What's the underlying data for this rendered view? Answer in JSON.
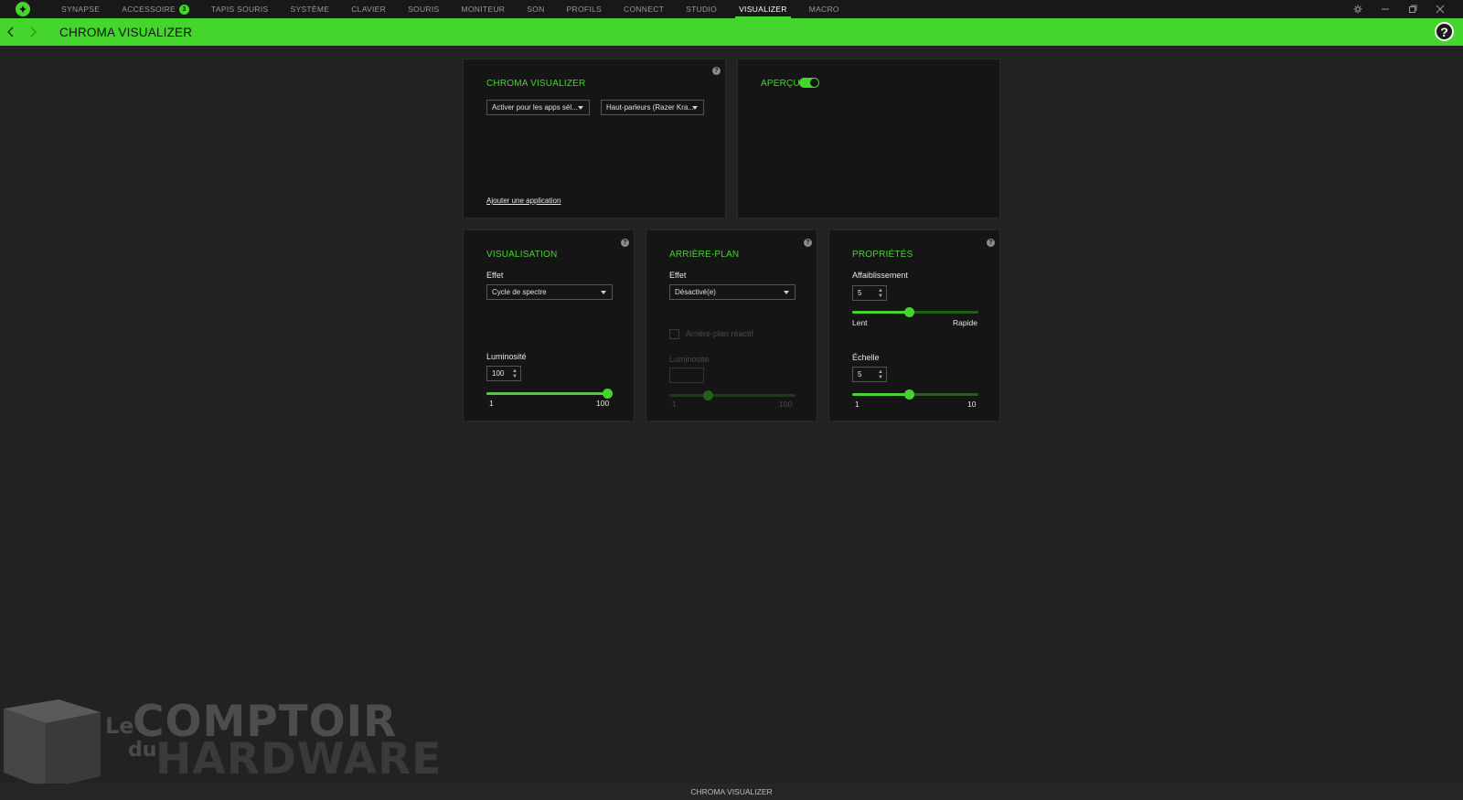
{
  "nav": {
    "items": [
      "SYNAPSE",
      "ACCESSOIRE",
      "TAPIS SOURIS",
      "SYSTÈME",
      "CLAVIER",
      "SOURIS",
      "MONITEUR",
      "SON",
      "PROFILS",
      "CONNECT",
      "STUDIO",
      "VISUALIZER",
      "MACRO"
    ],
    "active": "VISUALIZER",
    "accessoire_badge": "3"
  },
  "header": {
    "title": "CHROMA VISUALIZER"
  },
  "chroma_panel": {
    "title": "CHROMA VISUALIZER",
    "app_select": "Activer pour les apps sél...",
    "audio_select": "Haut-parleurs (Razer Kra...",
    "add_app_link": "Ajouter une application"
  },
  "preview_panel": {
    "title": "APERÇU",
    "toggle_on": true
  },
  "visualisation_panel": {
    "title": "VISUALISATION",
    "effect_label": "Effet",
    "effect_value": "Cycle de spectre",
    "brightness_label": "Luminosité",
    "brightness_value": "100",
    "brightness_level": 100,
    "min_label": "1",
    "max_label": "100"
  },
  "background_panel": {
    "title": "ARRIÈRE-PLAN",
    "effect_label": "Effet",
    "effect_value": "Désactivé(e)",
    "reactive_label": "Arrière-plan réactif",
    "brightness_label": "Luminosité",
    "brightness_value": "",
    "min_label": "1",
    "max_label": "100"
  },
  "properties_panel": {
    "title": "PROPRIÉTÉS",
    "decay_label": "Affaiblissement",
    "decay_value": "5",
    "decay_level": 5,
    "decay_min_label": "Lent",
    "decay_max_label": "Rapide",
    "scale_label": "Échelle",
    "scale_value": "5",
    "scale_level": 5,
    "scale_min_label": "1",
    "scale_max_label": "10"
  },
  "watermark": {
    "line1": "Le",
    "line2": "COMPTOIR",
    "line3": "du",
    "line4": "HARDWARE"
  },
  "statusbar": {
    "text": "CHROMA VISUALIZER"
  },
  "colors": {
    "accent": "#44d62c",
    "panel_bg": "#151515",
    "page_bg": "#222222"
  }
}
